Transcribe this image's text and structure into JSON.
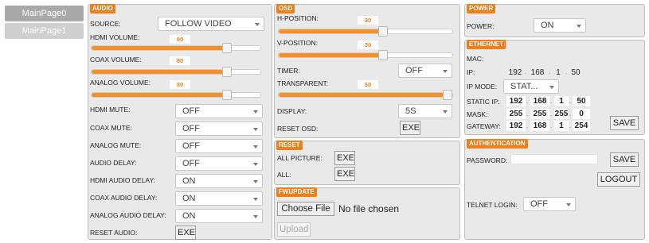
{
  "nav": {
    "tabs": [
      {
        "label": "MainPage0"
      },
      {
        "label": "MainPage1"
      }
    ]
  },
  "audio": {
    "title": "AUDIO",
    "source": {
      "label": "SOURCE:",
      "value": "FOLLOW VIDEO"
    },
    "hdmi_volume": {
      "label": "HDMI VOLUME:",
      "value": "80",
      "level": 0.8
    },
    "coax_volume": {
      "label": "COAX VOLUME:",
      "value": "80",
      "level": 0.8
    },
    "analog_volume": {
      "label": "ANALOG VOLUME:",
      "value": "80",
      "level": 0.8
    },
    "hdmi_mute": {
      "label": "HDMI MUTE:",
      "value": "OFF"
    },
    "coax_mute": {
      "label": "COAX MUTE:",
      "value": "OFF"
    },
    "analog_mute": {
      "label": "ANALOG MUTE:",
      "value": "OFF"
    },
    "audio_delay": {
      "label": "AUDIO DELAY:",
      "value": "OFF"
    },
    "hdmi_audio_delay": {
      "label": "HDMI AUDIO DELAY:",
      "value": "ON"
    },
    "coax_audio_delay": {
      "label": "COAX AUDIO DELAY:",
      "value": "ON"
    },
    "analog_audio_delay": {
      "label": "ANALOG AUDIO DELAY:",
      "value": "ON"
    },
    "reset_audio": {
      "label": "RESET AUDIO:",
      "button": "EXE"
    }
  },
  "osd": {
    "title": "OSD",
    "h_position": {
      "label": "H-POSITION:",
      "value": "30",
      "level": 0.6
    },
    "v_position": {
      "label": "V-POSITION:",
      "value": "30",
      "level": 0.6
    },
    "timer": {
      "label": "TIMER:",
      "value": "OFF"
    },
    "transparent": {
      "label": "TRANSPARENT:",
      "value": "50",
      "level": 1.0
    },
    "display": {
      "label": "DISPLAY:",
      "value": "5S"
    },
    "reset_osd": {
      "label": "RESET OSD:",
      "button": "EXE"
    }
  },
  "reset": {
    "title": "RESET",
    "all_picture": {
      "label": "ALL PICTURE:",
      "button": "EXE"
    },
    "all": {
      "label": "ALL:",
      "button": "EXE"
    }
  },
  "fwupdate": {
    "title": "FWUPDATE",
    "choose_file": "Choose File",
    "no_file": "No file chosen",
    "upload": "Upload"
  },
  "power": {
    "title": "POWER",
    "power": {
      "label": "POWER:",
      "value": "ON"
    }
  },
  "ethernet": {
    "title": "ETHERNET",
    "mac_label": "MAC:",
    "ip_label": "IP:",
    "ip": [
      "192",
      "168",
      "1",
      "50"
    ],
    "ip_mode": {
      "label": "IP MODE:",
      "value": "STAT..."
    },
    "static_ip": {
      "label": "STATIC IP:",
      "octets": [
        "192",
        "168",
        "1",
        "50"
      ]
    },
    "mask": {
      "label": "MASK:",
      "octets": [
        "255",
        "255",
        "255",
        "0"
      ]
    },
    "gateway": {
      "label": "GATEWAY:",
      "octets": [
        "192",
        "168",
        "1",
        "254"
      ]
    },
    "save": "SAVE"
  },
  "authentication": {
    "title": "AUTHENTICATION",
    "password_label": "PASSWORD:",
    "save": "SAVE",
    "logout": "LOGOUT",
    "telnet_login": {
      "label": "TELNET LOGIN:",
      "value": "OFF"
    }
  },
  "colors": {
    "accent": "#f07f1b",
    "panel_bg": "#e9e9e9"
  }
}
